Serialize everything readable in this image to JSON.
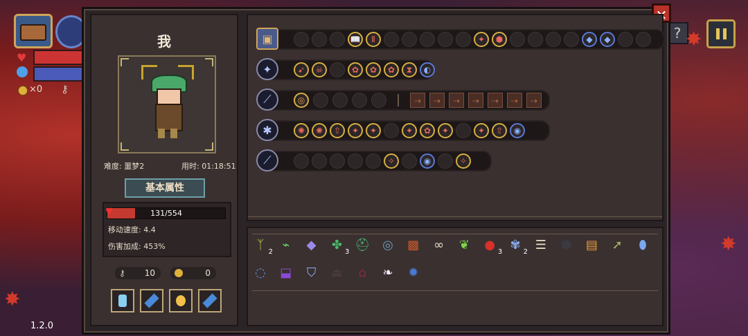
{
  "hud": {
    "coins": "×0",
    "version": "1.2.0",
    "help": "?"
  },
  "character": {
    "name": "我",
    "difficulty": "难度: 噩梦2",
    "time": "用时: 01:18:51",
    "stats_tab": "基本属性",
    "hp": "131/554",
    "hp_fraction": 0.237,
    "move_speed": "移动速度: 4.4",
    "damage_bonus": "伤害加成: 453%",
    "keys": "10",
    "gold": "0"
  },
  "colors": {
    "accent": "#d9b040",
    "hp": "#c53a30",
    "panel": "#2b2426",
    "close": "#b8322a"
  },
  "weapon_rows": [
    {
      "icon": "chest-icon",
      "slots": 20
    },
    {
      "icon": "staff-icon",
      "slots": 8
    },
    {
      "icon": "sword-icon",
      "slots": 12
    },
    {
      "icon": "mace-icon",
      "slots": 13
    },
    {
      "icon": "dagger-icon",
      "slots": 10
    }
  ],
  "items": [
    {
      "icon": "antler-icon",
      "count": "2"
    },
    {
      "icon": "syringe-icon",
      "count": ""
    },
    {
      "icon": "crystal-icon",
      "count": ""
    },
    {
      "icon": "clover-icon",
      "count": "3"
    },
    {
      "icon": "helmet-icon",
      "count": ""
    },
    {
      "icon": "compass-icon",
      "count": ""
    },
    {
      "icon": "cube-icon",
      "count": ""
    },
    {
      "icon": "glasses-icon",
      "count": ""
    },
    {
      "icon": "leaf-icon",
      "count": ""
    },
    {
      "icon": "eye-icon",
      "count": "3"
    },
    {
      "icon": "lotus-icon",
      "count": "2"
    },
    {
      "icon": "ribcage-icon",
      "count": ""
    },
    {
      "icon": "gear-icon",
      "count": ""
    },
    {
      "icon": "scroll-icon",
      "count": ""
    },
    {
      "icon": "arrow-icon",
      "count": ""
    },
    {
      "icon": "mirror-icon",
      "count": ""
    },
    {
      "icon": "ring-icon",
      "count": ""
    },
    {
      "icon": "boot-icon",
      "count": ""
    },
    {
      "icon": "shield-icon",
      "count": ""
    },
    {
      "icon": "cloak-icon",
      "count": ""
    },
    {
      "icon": "cape-icon",
      "count": ""
    },
    {
      "icon": "wing-icon",
      "count": ""
    },
    {
      "icon": "orb-icon",
      "count": ""
    }
  ]
}
